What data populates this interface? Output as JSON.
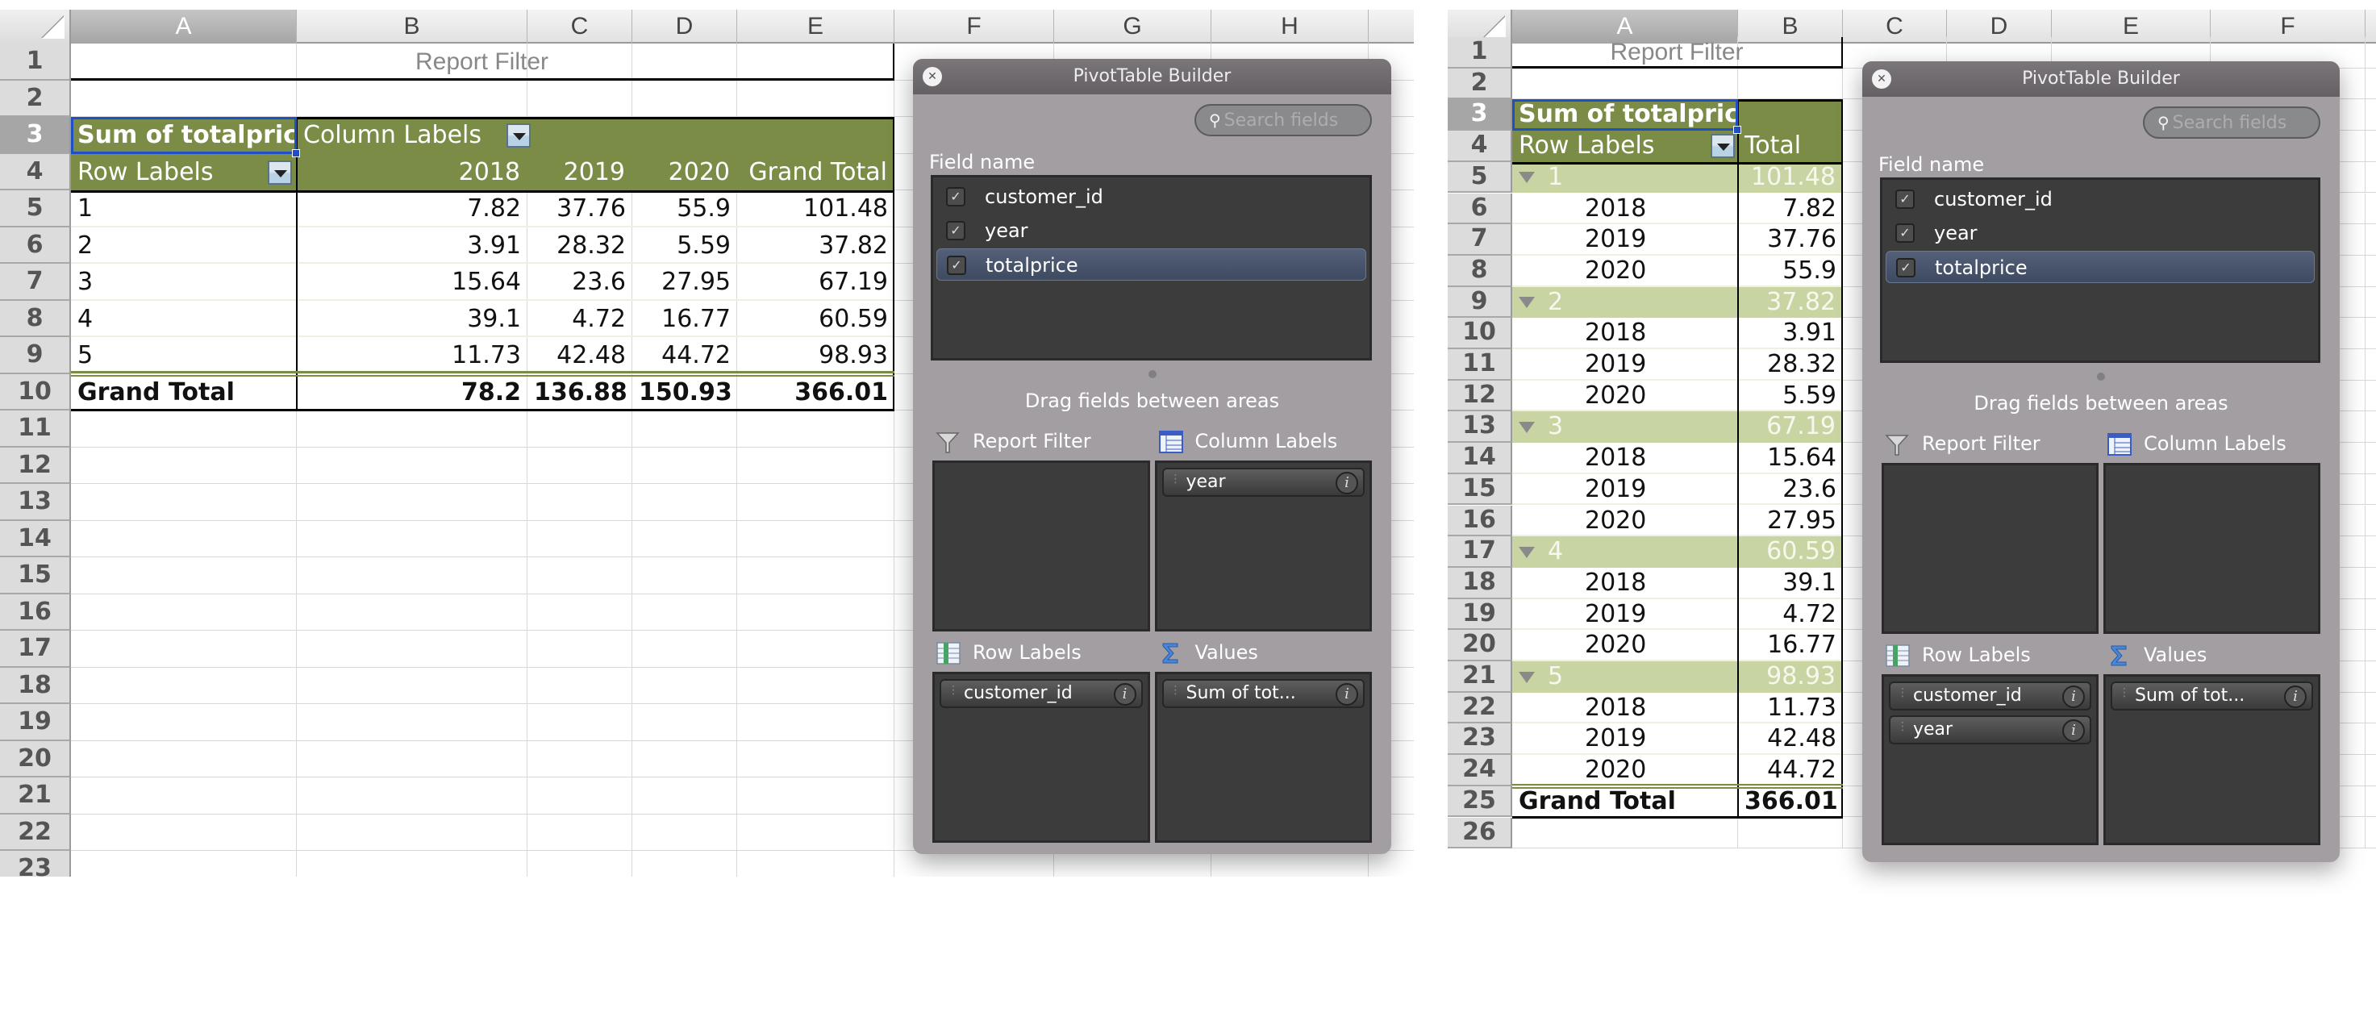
{
  "left_sheet": {
    "columns": [
      "A",
      "B",
      "C",
      "D",
      "E",
      "F",
      "G",
      "H"
    ],
    "selected_column": "A",
    "selected_row": 3,
    "row_numbers": [
      "1",
      "2",
      "3",
      "4",
      "5",
      "6",
      "7",
      "8",
      "9",
      "10",
      "11",
      "12",
      "13",
      "14",
      "15",
      "16",
      "17",
      "18",
      "19",
      "20",
      "21",
      "22",
      "23"
    ],
    "report_filter_label": "Report Filter",
    "pivot": {
      "value_field_header": "Sum of totalprice",
      "column_labels_header": "Column Labels",
      "row_labels_header": "Row Labels",
      "column_headers": [
        "2018",
        "2019",
        "2020",
        "Grand Total"
      ],
      "rows": [
        {
          "label": "1",
          "values": [
            "7.82",
            "37.76",
            "55.9",
            "101.48"
          ]
        },
        {
          "label": "2",
          "values": [
            "3.91",
            "28.32",
            "5.59",
            "37.82"
          ]
        },
        {
          "label": "3",
          "values": [
            "15.64",
            "23.6",
            "27.95",
            "67.19"
          ]
        },
        {
          "label": "4",
          "values": [
            "39.1",
            "4.72",
            "16.77",
            "60.59"
          ]
        },
        {
          "label": "5",
          "values": [
            "11.73",
            "42.48",
            "44.72",
            "98.93"
          ]
        }
      ],
      "grand_total": {
        "label": "Grand Total",
        "values": [
          "78.2",
          "136.88",
          "150.93",
          "366.01"
        ]
      }
    },
    "builder": {
      "title": "PivotTable Builder",
      "search_placeholder": "Search fields",
      "field_name_label": "Field name",
      "fields": [
        {
          "name": "customer_id",
          "checked": true,
          "selected": false
        },
        {
          "name": "year",
          "checked": true,
          "selected": false
        },
        {
          "name": "totalprice",
          "checked": true,
          "selected": true
        }
      ],
      "drag_hint": "Drag fields between areas",
      "areas": {
        "report_filter": {
          "label": "Report Filter",
          "items": []
        },
        "column_labels": {
          "label": "Column Labels",
          "items": [
            "year"
          ]
        },
        "row_labels": {
          "label": "Row Labels",
          "items": [
            "customer_id"
          ]
        },
        "values": {
          "label": "Values",
          "items": [
            "Sum of tot..."
          ]
        }
      }
    }
  },
  "right_sheet": {
    "columns": [
      "A",
      "B",
      "C",
      "D",
      "E",
      "F"
    ],
    "selected_column": "A",
    "selected_row": 3,
    "row_numbers": [
      "1",
      "2",
      "3",
      "4",
      "5",
      "6",
      "7",
      "8",
      "9",
      "10",
      "11",
      "12",
      "13",
      "14",
      "15",
      "16",
      "17",
      "18",
      "19",
      "20",
      "21",
      "22",
      "23",
      "24",
      "25",
      "26"
    ],
    "report_filter_label": "Report Filter",
    "pivot": {
      "value_field_header": "Sum of totalprice",
      "row_labels_header": "Row Labels",
      "total_header": "Total",
      "groups": [
        {
          "label": "1",
          "total": "101.48",
          "children": [
            {
              "label": "2018",
              "value": "7.82"
            },
            {
              "label": "2019",
              "value": "37.76"
            },
            {
              "label": "2020",
              "value": "55.9"
            }
          ]
        },
        {
          "label": "2",
          "total": "37.82",
          "children": [
            {
              "label": "2018",
              "value": "3.91"
            },
            {
              "label": "2019",
              "value": "28.32"
            },
            {
              "label": "2020",
              "value": "5.59"
            }
          ]
        },
        {
          "label": "3",
          "total": "67.19",
          "children": [
            {
              "label": "2018",
              "value": "15.64"
            },
            {
              "label": "2019",
              "value": "23.6"
            },
            {
              "label": "2020",
              "value": "27.95"
            }
          ]
        },
        {
          "label": "4",
          "total": "60.59",
          "children": [
            {
              "label": "2018",
              "value": "39.1"
            },
            {
              "label": "2019",
              "value": "4.72"
            },
            {
              "label": "2020",
              "value": "16.77"
            }
          ]
        },
        {
          "label": "5",
          "total": "98.93",
          "children": [
            {
              "label": "2018",
              "value": "11.73"
            },
            {
              "label": "2019",
              "value": "42.48"
            },
            {
              "label": "2020",
              "value": "44.72"
            }
          ]
        }
      ],
      "grand_total": {
        "label": "Grand Total",
        "value": "366.01"
      }
    },
    "builder": {
      "title": "PivotTable Builder",
      "search_placeholder": "Search fields",
      "field_name_label": "Field name",
      "fields": [
        {
          "name": "customer_id",
          "checked": true,
          "selected": false
        },
        {
          "name": "year",
          "checked": true,
          "selected": false
        },
        {
          "name": "totalprice",
          "checked": true,
          "selected": true
        }
      ],
      "drag_hint": "Drag fields between areas",
      "areas": {
        "report_filter": {
          "label": "Report Filter",
          "items": []
        },
        "column_labels": {
          "label": "Column Labels",
          "items": []
        },
        "row_labels": {
          "label": "Row Labels",
          "items": [
            "customer_id",
            "year"
          ]
        },
        "values": {
          "label": "Values",
          "items": [
            "Sum of tot..."
          ]
        }
      }
    }
  },
  "icons": {
    "close": "✕",
    "search": "🔍",
    "check": "✓",
    "info": "i",
    "collapse": "▼"
  },
  "colors": {
    "pivot_header": "#7a8c46",
    "pivot_subtotal": "#c8d5a3",
    "selection": "#1f4fc4",
    "builder_bg": "#a29ea2",
    "builder_well": "#3c3c3c"
  }
}
